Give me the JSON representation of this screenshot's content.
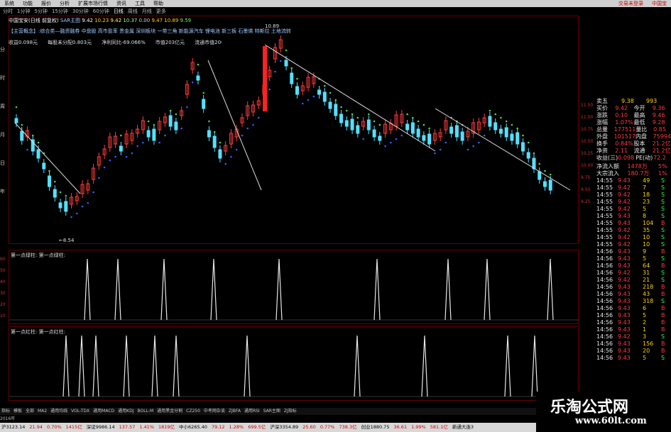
{
  "menu": {
    "items": [
      "系统",
      "功能",
      "报价",
      "分析",
      "扩展市场行情",
      "资讯",
      "工具",
      "帮助"
    ],
    "right_text": "交易未登录",
    "right_text2": "中国宝"
  },
  "periods": [
    "分时",
    "1分钟",
    "5分钟",
    "15分钟",
    "30分钟",
    "60分钟",
    "日线",
    "周线",
    "月线",
    "更多"
  ],
  "title": {
    "name": "中国宝安(日线 前复权)",
    "indicator": "SAR主图",
    "values": [
      "9.42",
      "10.23",
      "9.42",
      "10.37",
      "0.00",
      "9.47",
      "10.89",
      "9.59"
    ]
  },
  "ticker_text": "【主营概念】:综合类—融资融券 中盘股 高市盈率 贵金属 深圳板块 一带三角 新能源汽车 锂电池 新三板 石墨烯 特斯拉 土地流转",
  "fund": {
    "eps": "收益0.098元",
    "nav": "每股未分配0.803元",
    "profit_growth": "净利同比-69.066%",
    "mkt_cap": "市值203亿元",
    "float_cap": "流通市值200亿元"
  },
  "price_axis": {
    "ticks": [
      "11.50",
      "11.00",
      "10.75",
      "10.50",
      "10.25",
      "10.00",
      "9.75",
      "9.50",
      "9.25"
    ],
    "low_label": "8.54",
    "high_label": "10.89"
  },
  "ind1": {
    "title": "第一点绿柱: 第一点绿柱:",
    "ticks": [
      "60",
      "50",
      "40",
      "30",
      "20",
      "10"
    ]
  },
  "ind2": {
    "title": "第一点红柱: 第一点红柱:"
  },
  "left_labels": [
    "分",
    "时",
    "周",
    "月",
    "日",
    "年"
  ],
  "quote": {
    "rows": [
      {
        "k": "卖五",
        "v": "9.38",
        "n": "993",
        "c": "yellow"
      },
      {
        "k": "买价",
        "v": "9.42",
        "k2": "今开",
        "v2": "9.36"
      },
      {
        "k": "涨跌",
        "v": "0.10",
        "k2": "最高",
        "v2": "9.46"
      },
      {
        "k": "涨幅",
        "v": "1.07%",
        "k2": "最低",
        "v2": "9.28"
      },
      {
        "k": "总量",
        "v": "177511",
        "k2": "量比",
        "v2": "0.85"
      },
      {
        "k": "外盘",
        "v": "101517",
        "k2": "内盘",
        "v2": "75994"
      },
      {
        "k": "换手",
        "v": "0.84%",
        "k2": "股本",
        "v2": "21.2亿"
      },
      {
        "k": "净资",
        "v": "2.11",
        "k2": "流通",
        "v2": "21.2亿"
      },
      {
        "k": "收益(三)",
        "v": "0.098",
        "k2": "PE(动)",
        "v2": "72.2"
      }
    ],
    "flow_in": {
      "k": "净流入额",
      "v": "1478万",
      "p": "5%"
    },
    "big_in": {
      "k": "大宗流入",
      "v": "180.7万",
      "p": "1%"
    },
    "ticks": [
      [
        "14:55",
        "9.43",
        "49",
        "S"
      ],
      [
        "14:55",
        "9.42",
        "7",
        "S"
      ],
      [
        "14:55",
        "9.42",
        "18",
        "S"
      ],
      [
        "14:55",
        "9.42",
        "23",
        "S"
      ],
      [
        "14:55",
        "9.42",
        "5",
        "S"
      ],
      [
        "14:55",
        "9.43",
        "8",
        "S"
      ],
      [
        "14:55",
        "9.43",
        "104",
        "B"
      ],
      [
        "14:55",
        "9.42",
        "35",
        "S"
      ],
      [
        "14:55",
        "9.42",
        "10",
        "S"
      ],
      [
        "14:55",
        "9.42",
        "10",
        "S"
      ],
      [
        "14:56",
        "9.43",
        "9",
        "B"
      ],
      [
        "14:56",
        "9.43",
        "5",
        "S"
      ],
      [
        "14:56",
        "9.43",
        "64",
        "B"
      ],
      [
        "14:56",
        "9.42",
        "31",
        "S"
      ],
      [
        "14:56",
        "9.42",
        "21",
        "S"
      ],
      [
        "14:56",
        "9.43",
        "218",
        "B"
      ],
      [
        "14:56",
        "9.43",
        "43",
        "B"
      ],
      [
        "14:56",
        "9.43",
        "318",
        "S"
      ],
      [
        "14:56",
        "9.43",
        "6",
        "B"
      ],
      [
        "14:56",
        "9.43",
        "5",
        "B"
      ],
      [
        "14:56",
        "9.43",
        "2",
        "B"
      ],
      [
        "14:56",
        "9.43",
        "1",
        "B"
      ],
      [
        "14:56",
        "9.42",
        "3",
        "S"
      ],
      [
        "14:56",
        "9.43",
        "156",
        "B"
      ],
      [
        "14:56",
        "9.43",
        "20",
        "B"
      ],
      [
        "14:56",
        "9.43",
        "5",
        "S"
      ]
    ]
  },
  "watermark": {
    "title": "乐淘公式网",
    "url": "www.60lt.com"
  },
  "bottom_tabs": [
    "指标",
    "模板",
    "全部",
    "MA2",
    "通用均线",
    "VOL-TDX",
    "通用MACD",
    "通用KDJ",
    "BOLL-M",
    "通用黑金分割",
    "CZ250",
    "中考网杂谈",
    "ZJBFA",
    "通用RSI",
    "SAR主图",
    "ZJ指标"
  ],
  "scroll_text": "2016年",
  "status": [
    "沪3123.14",
    "21.94",
    "0.70%",
    "1415亿",
    "深证9986.14",
    "137.57",
    "1.41%",
    "1819亿",
    "中小6265.40",
    "79.12",
    "1.28%",
    "699.5亿",
    "沪深3354.89",
    "25.60",
    "0.77%",
    "738.3亿",
    "创业1880.75",
    "36.61",
    "1.99%",
    "581.1亿"
  ],
  "status_end": "新通大连3"
}
